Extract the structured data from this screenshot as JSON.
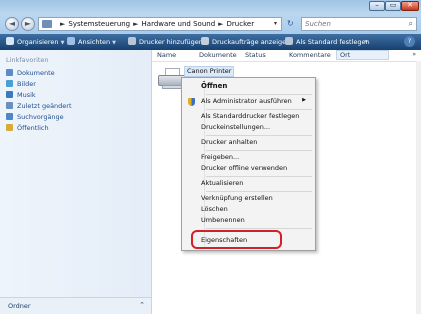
{
  "window": {
    "caption_buttons": [
      "–",
      "▭",
      "✕"
    ]
  },
  "nav_buttons": {
    "back": "◄",
    "forward": "►"
  },
  "address": {
    "crumbs": [
      "Systemsteuerung",
      "Hardware und Sound",
      "Drucker"
    ],
    "separator": "►",
    "dropdown": "▾",
    "refresh": "↻"
  },
  "search": {
    "placeholder": "Suchen",
    "icon": "⌕"
  },
  "toolbar": {
    "organize": "Organisieren",
    "views": "Ansichten",
    "add_printer": "Drucker hinzufügen",
    "show_jobs": "Druckaufträge anzeigen",
    "set_default": "Als Standard festlegen",
    "more": "»",
    "help": "?"
  },
  "sidebar": {
    "header": "Linkfavoriten",
    "items": [
      {
        "label": "Dokumente",
        "icon": "documents-icon",
        "color": "#5b8cc8"
      },
      {
        "label": "Bilder",
        "icon": "pictures-icon",
        "color": "#4aa0d4"
      },
      {
        "label": "Musik",
        "icon": "music-icon",
        "color": "#3c7ac0"
      },
      {
        "label": "Zuletzt geändert",
        "icon": "recent-icon",
        "color": "#6b8fbf"
      },
      {
        "label": "Suchvorgänge",
        "icon": "searches-icon",
        "color": "#4f86c6"
      },
      {
        "label": "Öffentlich",
        "icon": "public-folder-icon",
        "color": "#d9a93a"
      }
    ],
    "footer": "Ordner",
    "footer_chevron": "⌃"
  },
  "columns": {
    "name": "Name",
    "documents": "Dokumente",
    "status": "Status",
    "comments": "Kommentare",
    "location": "Ort",
    "more": "»"
  },
  "printer": {
    "name": "Canon Printer"
  },
  "context_menu": {
    "open": "Öffnen",
    "run_as_admin": "Als Administrator ausführen",
    "submenu_arrow": "▶",
    "set_default": "Als Standarddrucker festlegen",
    "preferences": "Druckeinstellungen...",
    "pause": "Drucker anhalten",
    "sharing": "Freigeben...",
    "offline": "Drucker offline verwenden",
    "refresh": "Aktualisieren",
    "shortcut": "Verknüpfung erstellen",
    "delete": "Löschen",
    "rename": "Umbenennen",
    "properties": "Eigenschaften"
  },
  "colors": {
    "toolbar": "#2a5a8e",
    "highlight_ring": "#d0202a",
    "link": "#1f4f8d"
  }
}
